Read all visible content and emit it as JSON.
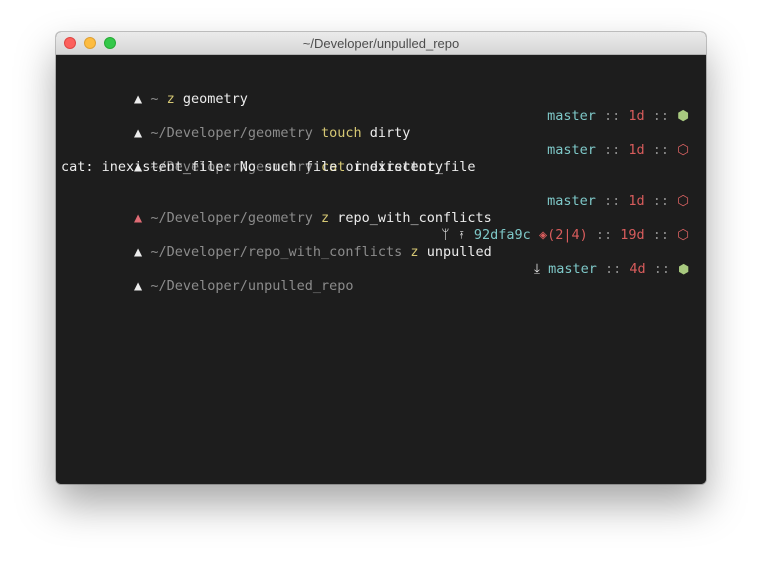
{
  "window": {
    "title": "~/Developer/unpulled_repo"
  },
  "prompt": {
    "symbol": "▲",
    "tilde": "~"
  },
  "lines": [
    {
      "path": "~",
      "command": "z",
      "args": "geometry"
    },
    {
      "path": "~/Developer/geometry",
      "command": "touch",
      "args": "dirty",
      "branch": "master",
      "sep": "::",
      "time": "1d",
      "status_icon": "⬢",
      "status": "clean"
    },
    {
      "path": "~/Developer/geometry",
      "command": "cat",
      "args": "inexistent_file",
      "branch": "master",
      "sep": "::",
      "time": "1d",
      "status_icon": "⬡",
      "status": "dirty"
    },
    {
      "output": "cat: inexistent_file: No such file or directory"
    },
    {
      "path": "~/Developer/geometry",
      "command": "z",
      "args": "repo_with_conflicts",
      "branch": "master",
      "sep": "::",
      "time": "1d",
      "status_icon": "⬡",
      "status": "dirty",
      "exit_error": true
    },
    {
      "path": "~/Developer/repo_with_conflicts",
      "command": "z",
      "args": "unpulled",
      "merge_icon": "ᛘ",
      "ahead_icon": "⤒",
      "hash": "92dfa9c",
      "conflict_icon": "◈",
      "conflicts": "(2|4)",
      "sep": "::",
      "time": "19d",
      "status_icon": "⬡",
      "status": "dirty"
    },
    {
      "path": "~/Developer/unpulled_repo",
      "behind_icon": "⤓",
      "branch": "master",
      "sep": "::",
      "time": "4d",
      "status_icon": "⬢",
      "status": "clean"
    }
  ]
}
